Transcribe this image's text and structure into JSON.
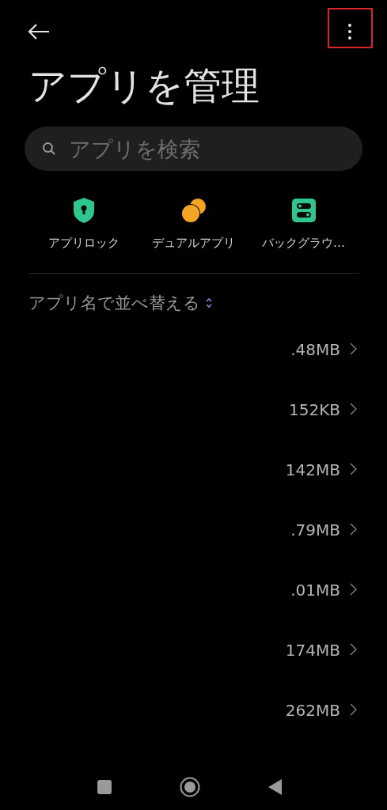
{
  "header": {
    "title": "アプリを管理",
    "highlight_menu": true
  },
  "search": {
    "placeholder": "アプリを検索"
  },
  "shortcuts": [
    {
      "kind": "lock",
      "label": "アプリロック"
    },
    {
      "kind": "dual",
      "label": "デュアルアプリ"
    },
    {
      "kind": "toggles",
      "label": "バックグラウ…"
    }
  ],
  "sort": {
    "label": "アプリ名で並べ替える"
  },
  "apps": [
    {
      "size": ".48MB"
    },
    {
      "size": "152KB"
    },
    {
      "size": "142MB"
    },
    {
      "size": ".79MB"
    },
    {
      "size": ".01MB"
    },
    {
      "size": "174MB"
    },
    {
      "size": "262MB"
    }
  ]
}
